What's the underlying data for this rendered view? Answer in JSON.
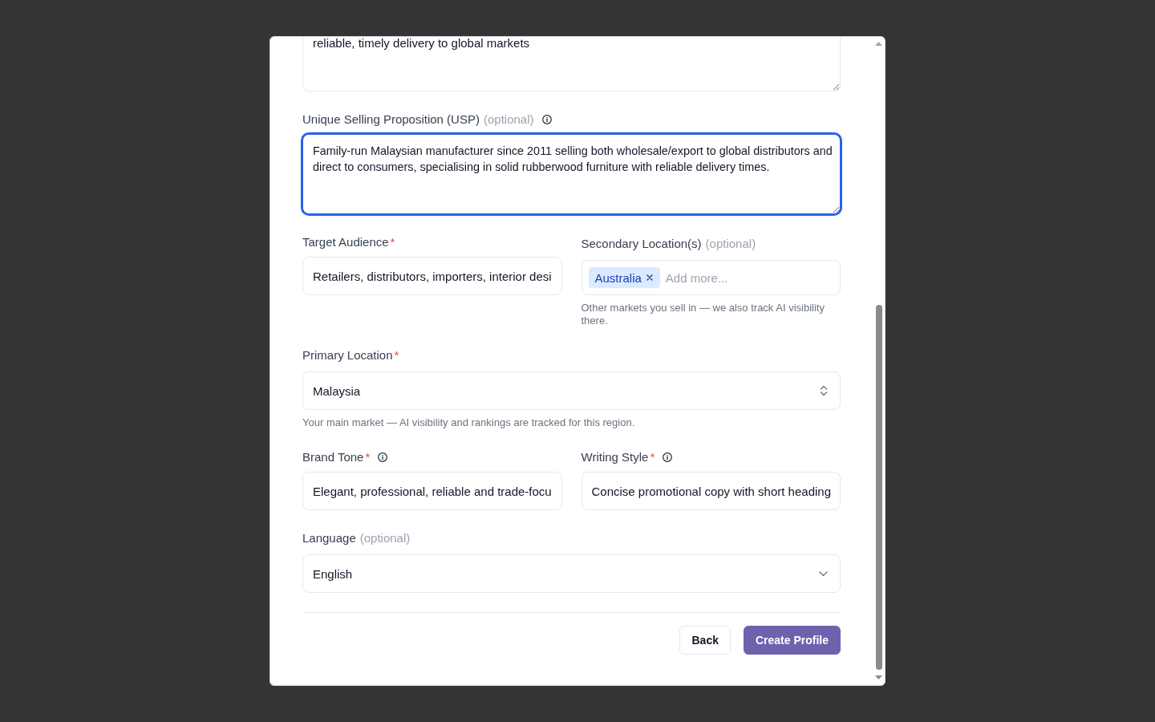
{
  "dialog": {
    "rows": [
      {
        "fields": [
          {
            "kind": "textarea",
            "clipped": true,
            "value": "reliable, timely delivery to global markets",
            "focused": false
          }
        ]
      },
      {
        "fields": [
          {
            "kind": "textarea",
            "clipped": false,
            "label": "Unique Selling Proposition (USP)",
            "optional_note": "(optional)",
            "has_info": true,
            "value": "Family-run Malaysian manufacturer since 2011 selling both wholesale/export to global distributors and direct to consumers, specialising in solid rubberwood furniture with reliable delivery times.",
            "focused": true
          }
        ]
      },
      {
        "fields": [
          {
            "kind": "input",
            "label": "Target Audience",
            "required_mark": "*",
            "has_info": false,
            "value": "Retailers, distributors, importers, interior desi",
            "focused": false
          },
          {
            "kind": "tags",
            "label": "Secondary Location(s)",
            "optional_note": "(optional)",
            "has_info": false,
            "tags": [
              {
                "label": "Australia"
              }
            ],
            "placeholder": "Add more...",
            "helper": "Other markets you sell in — we also track AI visibility there.",
            "focused": false
          }
        ]
      },
      {
        "fields": [
          {
            "kind": "combobox",
            "label": "Primary Location",
            "required_mark": "*",
            "has_info": false,
            "value": "Malaysia",
            "helper": "Your main market — AI visibility and rankings are tracked for this region.",
            "focused": false
          }
        ]
      },
      {
        "fields": [
          {
            "kind": "input",
            "label": "Brand Tone",
            "required_mark": "*",
            "has_info": true,
            "value": "Elegant, professional, reliable and trade-focu",
            "focused": false
          },
          {
            "kind": "input",
            "label": "Writing Style",
            "required_mark": "*",
            "has_info": true,
            "value": "Concise promotional copy with short heading",
            "focused": false
          }
        ]
      },
      {
        "fields": [
          {
            "kind": "select",
            "label": "Language",
            "optional_note": "(optional)",
            "has_info": false,
            "value": "English",
            "focused": false
          }
        ]
      }
    ],
    "buttons": [
      {
        "label": "Back",
        "kind": "secondary"
      },
      {
        "label": "Create Profile",
        "kind": "primary"
      }
    ]
  }
}
